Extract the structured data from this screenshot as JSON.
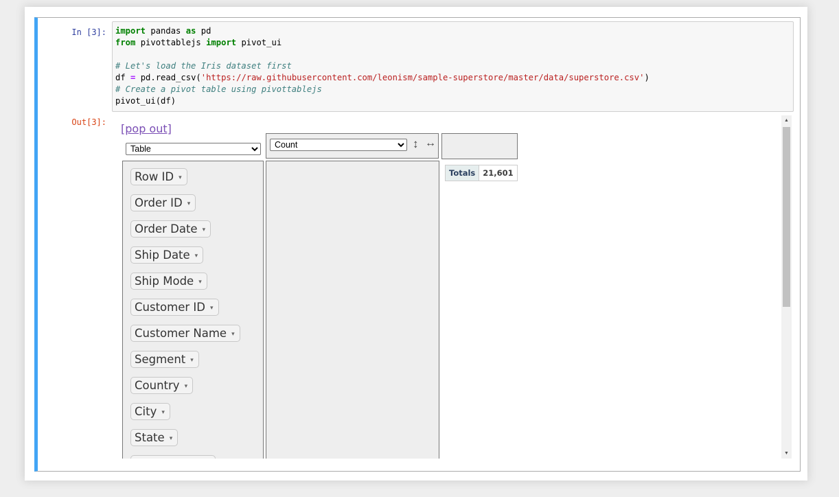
{
  "cell": {
    "in_prompt": "In [3]:",
    "out_prompt": "Out[3]:",
    "code_lines": [
      [
        {
          "t": "import",
          "c": "kw"
        },
        {
          "t": " pandas ",
          "c": ""
        },
        {
          "t": "as",
          "c": "kw"
        },
        {
          "t": " pd",
          "c": ""
        }
      ],
      [
        {
          "t": "from",
          "c": "kw"
        },
        {
          "t": " pivottablejs ",
          "c": ""
        },
        {
          "t": "import",
          "c": "kw"
        },
        {
          "t": " pivot_ui",
          "c": ""
        }
      ],
      [],
      [
        {
          "t": "# Let's load the Iris dataset first",
          "c": "cm"
        }
      ],
      [
        {
          "t": "df ",
          "c": ""
        },
        {
          "t": "=",
          "c": "op"
        },
        {
          "t": " pd.read_csv(",
          "c": ""
        },
        {
          "t": "'https://raw.githubusercontent.com/leonism/sample-superstore/master/data/superstore.csv'",
          "c": "st"
        },
        {
          "t": ")",
          "c": ""
        }
      ],
      [
        {
          "t": "# Create a pivot table using pivottablejs",
          "c": "cm"
        }
      ],
      [
        {
          "t": "pivot_ui(df)",
          "c": ""
        }
      ]
    ]
  },
  "output": {
    "popout_label": "[pop out]",
    "renderer_selected": "Table",
    "aggregator_selected": "Count",
    "sort_icon": "↕",
    "order_icon": "↔",
    "attributes": [
      "Row ID",
      "Order ID",
      "Order Date",
      "Ship Date",
      "Ship Mode",
      "Customer ID",
      "Customer Name",
      "Segment",
      "Country",
      "City",
      "State"
    ],
    "dropdown_marker": "▾",
    "table": {
      "totals_label": "Totals",
      "totals_value": "21,601"
    }
  },
  "scrollbar": {
    "up_arrow": "▲",
    "down_arrow": "▼"
  }
}
